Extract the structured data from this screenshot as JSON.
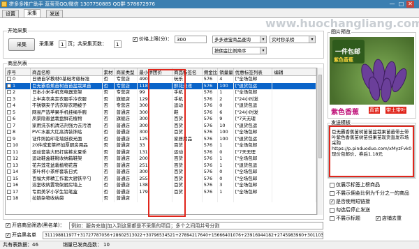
{
  "window": {
    "title": "拼多多推广助手 蓝莹亮QQ/微信 1307750885 QQ群 578672976",
    "min": "—",
    "max": "□",
    "close": "✕"
  },
  "watermark": "www.huochangliang.com",
  "tabs": [
    {
      "label": "设置"
    },
    {
      "label": "采集"
    },
    {
      "label": "发送"
    }
  ],
  "collect": {
    "group_title": "开始采集",
    "button": "采集",
    "page_label": "采集第",
    "page_value": "1",
    "page_suffix": "页；共采集页数：",
    "total_value": "1",
    "price_label": "价格上限(分)：",
    "price_value": "300",
    "category": "多多进宝商品查询",
    "sort_by": "按佣金比例降序",
    "realtime": "实时秒杀榜"
  },
  "list": {
    "group_title": "商品列表",
    "columns": [
      "序号",
      "商品名称",
      "素材",
      "商家类型",
      "最小拼团价",
      "商品标签名",
      "佣金比",
      "销量量",
      "优惠标签列表",
      "编辑"
    ],
    "selected_index": 1,
    "rows": [
      [
        "0",
        "日语自学教材0基础考级标准",
        "否",
        "专营店",
        "490",
        "玩乐",
        "576",
        "4",
        "[\"全场包邮"
      ],
      [
        "1",
        "巨无霸香蕉苗树苗苗盆栽果苗",
        "否",
        "专营店",
        "118",
        "鲜花速递",
        "576",
        "100",
        "[\"退货包运"
      ],
      [
        "2",
        "日本小米手机充电器支架",
        "否",
        "专营店",
        "99",
        "手机",
        "576",
        "1",
        "[\"全场包邮"
      ],
      [
        "3",
        "上半夹衣夹定衣服手冷衣服",
        "否",
        "旗舰店",
        "129",
        "手机",
        "576",
        "2",
        "[\"24小时发"
      ],
      [
        "4",
        "不锈钢夹子洗衣晾衣晒被子",
        "否",
        "专营店",
        "300",
        "运动",
        "576",
        "0",
        "[\"退货包运"
      ],
      [
        "5",
        "网易严选苹果手机挂绳手腕",
        "否",
        "普通店",
        "300",
        "鞋",
        "576",
        "6",
        "[\"24小时发"
      ],
      [
        "6",
        "夙景隐患盆栽盘鲜花植物",
        "否",
        "旗舰店",
        "300",
        "百货",
        "576",
        "9",
        "[\"7天无理"
      ],
      [
        "7",
        "家用洗衣机清洁剂强力去污渍",
        "否",
        "普通店",
        "300",
        "百货",
        "576",
        "10",
        "[\"退货包运"
      ],
      [
        "8",
        "PVC水墨大红高清装饰贴",
        "否",
        "普通店",
        "300",
        "百货",
        "576",
        "100",
        "[\"全场包邮"
      ],
      [
        "9",
        "证件照拍印花墙纸夜光面",
        "否",
        "普通店",
        "125",
        "家居用品",
        "576",
        "100",
        "[\"退货包运"
      ],
      [
        "10",
        "20件成套茶杯加厚厨房用品",
        "否",
        "普通店",
        "33",
        "百货",
        "576",
        "1",
        "[\"全场包邮"
      ],
      [
        "11",
        "运动套装大码打底裤女夏季",
        "否",
        "普通店",
        "131",
        "运动",
        "576",
        "0",
        "[\"7天无理"
      ],
      [
        "12",
        "运动鞋盒鞋靴收纳箱鞋架",
        "否",
        "普通店",
        "200",
        "百货",
        "576",
        "1",
        "[\"全场包邮"
      ],
      [
        "13",
        "花卉莲花盆栽植物花苗",
        "否",
        "普通店",
        "251",
        "百货",
        "576",
        "1",
        "[\"退货包运"
      ],
      [
        "14",
        "茶叶杯小茶杯套装日式",
        "否",
        "普通店",
        "300",
        "百货",
        "576",
        "0",
        "[\"全场包邮"
      ],
      [
        "15",
        "百福大师精工作套大厨铁平勺",
        "否",
        "普通店",
        "255",
        "百货",
        "576",
        "0",
        "[\"全场包邮"
      ],
      [
        "16",
        "浴室收纳置物架厨房墙上",
        "否",
        "普通店",
        "138",
        "百货",
        "576",
        "3",
        "[\"全场包邮"
      ],
      [
        "17",
        "专用美学小学生铅笔盒",
        "否",
        "普通店",
        "179",
        "百货",
        "576",
        "1",
        "[\"全场包邮"
      ],
      [
        "18",
        "拉链杂物收纳袋",
        "否",
        "普通店",
        "",
        "",
        "",
        "",
        ""
      ]
    ]
  },
  "filter": {
    "enable_label": "开启商品筛选(黑名单)：",
    "enabled": true,
    "text": "例如：服务充值|加入到这里都是不采集的项目；多个之间用并号分割"
  },
  "blacklist": {
    "enable_label": "开启黑名单",
    "enabled": true,
    "text": "311198811977+31727787056+28602513022+30796534521+27894217640+15666401076+23916944182+2745983960+30110347"
  },
  "preview": {
    "group_title": "图片预览",
    "banner_top": "一件包邮",
    "banner_mid": "紫色香蕉",
    "banner_bottom": "紫色香蕉",
    "tag_fresh": "真苗",
    "tag_ship": "带土带叶",
    "fruit_color": "#6b3f9a"
  },
  "send_template": {
    "group_title": "发送模板",
    "text": "巨无霸香蕉苗树苗苗盆栽果苗苗带土带叶紫色香蕉苗树苗挂果苗现货直发市场采购 https://p.pinduoduo.com/xMyzFvk0\n现价包邮价，券后1.18元"
  },
  "options": {
    "only_fill": {
      "label": "仅展示标签上榜商品",
      "checked": false
    },
    "min_commission": {
      "label": "不展示佣金比例为千分之一的商品",
      "checked": false
    },
    "short_link": {
      "label": "是否使用短链接",
      "checked": true
    },
    "stop_when": {
      "label": "勾选后停止发送",
      "checked": false
    },
    "no_tag": {
      "label": "不展示标题",
      "checked": false
    },
    "dedupe": {
      "label": "店铺去重",
      "checked": true
    }
  },
  "status": {
    "total_label": "共有表数据：",
    "total_value": "46",
    "sent_label": "销量已发商品数：",
    "sent_value": "10"
  }
}
